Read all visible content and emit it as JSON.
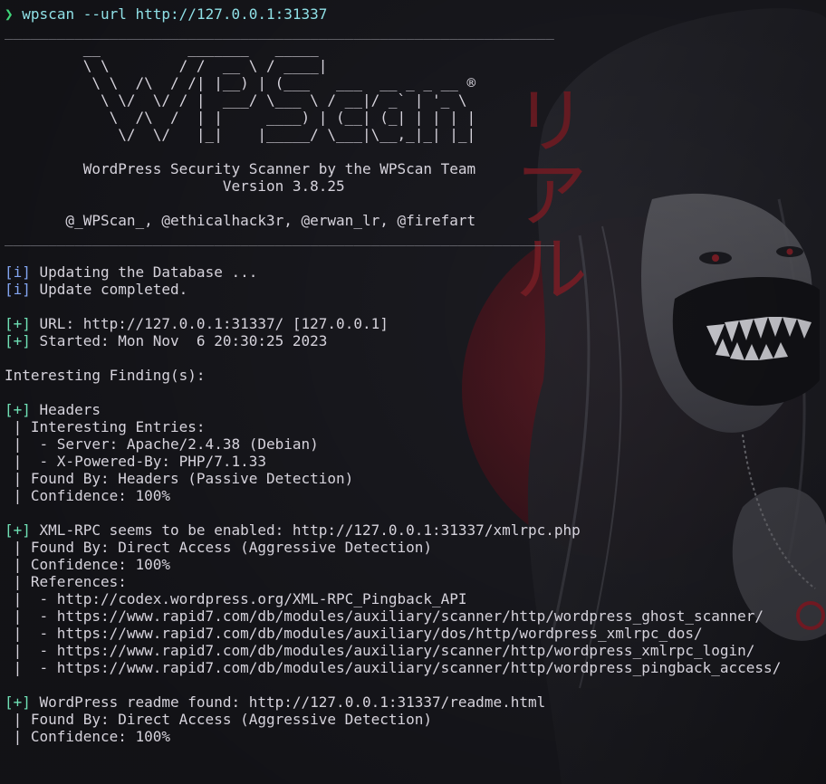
{
  "terminal": {
    "prompt_symbol": "❯",
    "command_name": "wpscan",
    "command_args": " --url http://127.0.0.1:31337",
    "separator": "_______________________________________________________________",
    "banner_art": [
      "         __          _______   _____",
      "         \\ \\        / /  __ \\ / ____|",
      "          \\ \\  /\\  / /| |__) | (___   ___  __ _ _ __ ®",
      "           \\ \\/  \\/ / |  ___/ \\___ \\ / __|/ _` | '_ \\",
      "            \\  /\\  /  | |     ____) | (__| (_| | | | |",
      "             \\/  \\/   |_|    |_____/ \\___|\\__,_|_| |_|"
    ],
    "banner_subtitle": "         WordPress Security Scanner by the WPScan Team",
    "banner_version": "                         Version 3.8.25",
    "banner_credits": "       @_WPScan_, @ethicalhack3r, @erwan_lr, @firefart",
    "output": [
      {
        "tag": "[i]",
        "tag_class": "tag-info",
        "text": " Updating the Database ..."
      },
      {
        "tag": "[i]",
        "tag_class": "tag-info",
        "text": " Update completed."
      },
      {
        "tag": "",
        "tag_class": "",
        "text": ""
      },
      {
        "tag": "[+]",
        "tag_class": "tag-plus",
        "text": " URL: http://127.0.0.1:31337/ [127.0.0.1]"
      },
      {
        "tag": "[+]",
        "tag_class": "tag-plus",
        "text": " Started: Mon Nov  6 20:30:25 2023"
      },
      {
        "tag": "",
        "tag_class": "",
        "text": ""
      },
      {
        "tag": "",
        "tag_class": "",
        "text": "Interesting Finding(s):"
      },
      {
        "tag": "",
        "tag_class": "",
        "text": ""
      },
      {
        "tag": "[+]",
        "tag_class": "tag-plus",
        "text": " Headers"
      },
      {
        "tag": "",
        "tag_class": "",
        "text": " | Interesting Entries:"
      },
      {
        "tag": "",
        "tag_class": "",
        "text": " |  - Server: Apache/2.4.38 (Debian)"
      },
      {
        "tag": "",
        "tag_class": "",
        "text": " |  - X-Powered-By: PHP/7.1.33"
      },
      {
        "tag": "",
        "tag_class": "",
        "text": " | Found By: Headers (Passive Detection)"
      },
      {
        "tag": "",
        "tag_class": "",
        "text": " | Confidence: 100%"
      },
      {
        "tag": "",
        "tag_class": "",
        "text": ""
      },
      {
        "tag": "[+]",
        "tag_class": "tag-plus",
        "text": " XML-RPC seems to be enabled: http://127.0.0.1:31337/xmlrpc.php"
      },
      {
        "tag": "",
        "tag_class": "",
        "text": " | Found By: Direct Access (Aggressive Detection)"
      },
      {
        "tag": "",
        "tag_class": "",
        "text": " | Confidence: 100%"
      },
      {
        "tag": "",
        "tag_class": "",
        "text": " | References:"
      },
      {
        "tag": "",
        "tag_class": "",
        "text": " |  - http://codex.wordpress.org/XML-RPC_Pingback_API"
      },
      {
        "tag": "",
        "tag_class": "",
        "text": " |  - https://www.rapid7.com/db/modules/auxiliary/scanner/http/wordpress_ghost_scanner/"
      },
      {
        "tag": "",
        "tag_class": "",
        "text": " |  - https://www.rapid7.com/db/modules/auxiliary/dos/http/wordpress_xmlrpc_dos/"
      },
      {
        "tag": "",
        "tag_class": "",
        "text": " |  - https://www.rapid7.com/db/modules/auxiliary/scanner/http/wordpress_xmlrpc_login/"
      },
      {
        "tag": "",
        "tag_class": "",
        "text": " |  - https://www.rapid7.com/db/modules/auxiliary/scanner/http/wordpress_pingback_access/"
      },
      {
        "tag": "",
        "tag_class": "",
        "text": ""
      },
      {
        "tag": "[+]",
        "tag_class": "tag-plus",
        "text": " WordPress readme found: http://127.0.0.1:31337/readme.html"
      },
      {
        "tag": "",
        "tag_class": "",
        "text": " | Found By: Direct Access (Aggressive Detection)"
      },
      {
        "tag": "",
        "tag_class": "",
        "text": " | Confidence: 100%"
      }
    ]
  },
  "background": {
    "kana_text": "リアル",
    "kana_color": "#7a1e26",
    "moon_color": "#5e1a22",
    "base_color": "#1b1b21"
  },
  "icons": {
    "prompt": "prompt-chevron-icon"
  }
}
